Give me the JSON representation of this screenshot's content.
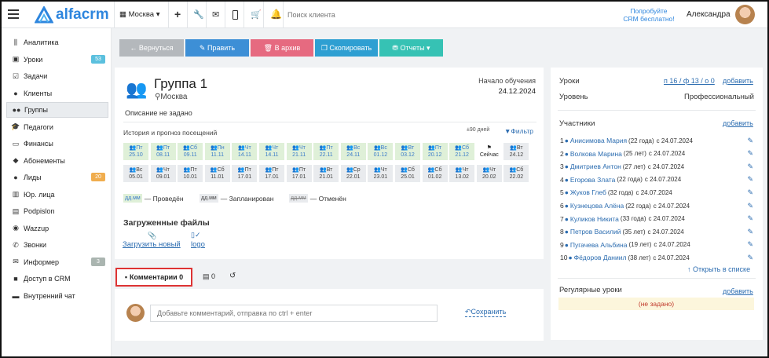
{
  "header": {
    "brand": "alfacrm",
    "city": "Москва",
    "search_placeholder": "Поиск клиента",
    "promo_line1": "Попробуйте",
    "promo_line2": "CRM бесплатно!",
    "user_name": "Александра"
  },
  "sidebar": {
    "items": [
      {
        "label": "Аналитика",
        "icon": "chart-icon",
        "glyph": "⫼"
      },
      {
        "label": "Уроки",
        "icon": "calendar-icon",
        "glyph": "▣",
        "badge": "53",
        "badge_color": "#5bc0de"
      },
      {
        "label": "Задачи",
        "icon": "tasks-icon",
        "glyph": "☑"
      },
      {
        "label": "Клиенты",
        "icon": "user-icon",
        "glyph": "●"
      },
      {
        "label": "Группы",
        "icon": "users-icon",
        "glyph": "●●",
        "active": true
      },
      {
        "label": "Педагоги",
        "icon": "graduation-cap-icon",
        "glyph": "🎓"
      },
      {
        "label": "Финансы",
        "icon": "money-icon",
        "glyph": "▭"
      },
      {
        "label": "Абонементы",
        "icon": "ticket-icon",
        "glyph": "◆"
      },
      {
        "label": "Лиды",
        "icon": "leads-icon",
        "glyph": "●",
        "badge": "20",
        "badge_color": "#f0ad4e"
      },
      {
        "label": "Юр. лица",
        "icon": "building-icon",
        "glyph": "▥"
      },
      {
        "label": "Podpislon",
        "icon": "document-icon",
        "glyph": "▤"
      },
      {
        "label": "Wazzup",
        "icon": "whatsapp-icon",
        "glyph": "◉"
      },
      {
        "label": "Звонки",
        "icon": "phone-icon",
        "glyph": "✆"
      },
      {
        "label": "Информер",
        "icon": "envelope-icon",
        "glyph": "✉",
        "badge": "3",
        "badge_color": "#aab5b0"
      },
      {
        "label": "Доступ в CRM",
        "icon": "lock-icon",
        "glyph": "■"
      },
      {
        "label": "Внутренний чат",
        "icon": "chat-icon",
        "glyph": "▬"
      }
    ]
  },
  "actions": {
    "back": "← Вернуться",
    "edit": "✎ Править",
    "archive": "🗑 В архив",
    "copy": "❐ Скопировать",
    "reports": "⛃ Отчеты ▾"
  },
  "group": {
    "title": "Группа 1",
    "city": "Москва",
    "start_label": "Начало обучения",
    "start_date": "24.12.2024",
    "description": "Описание не задано"
  },
  "attendance": {
    "title": "История и прогноз посещений",
    "days": "±90 дней",
    "filter": "Фильтр",
    "row1": [
      {
        "d": "Пт",
        "date": "25.10",
        "s": "g"
      },
      {
        "d": "Пт",
        "date": "08.11",
        "s": "g"
      },
      {
        "d": "Сб",
        "date": "09.11",
        "s": "g"
      },
      {
        "d": "Пн",
        "date": "11.11",
        "s": "g"
      },
      {
        "d": "Чт",
        "date": "14.11",
        "s": "g"
      },
      {
        "d": "Чт",
        "date": "14.11",
        "s": "g"
      },
      {
        "d": "Чт",
        "date": "21.11",
        "s": "g"
      },
      {
        "d": "Пт",
        "date": "22.11",
        "s": "g"
      },
      {
        "d": "Вс",
        "date": "24.11",
        "s": "g"
      },
      {
        "d": "Вс",
        "date": "01.12",
        "s": "g"
      },
      {
        "d": "Вт",
        "date": "03.12",
        "s": "g"
      },
      {
        "d": "Пт",
        "date": "20.12",
        "s": "g"
      },
      {
        "d": "Сб",
        "date": "21.12",
        "s": "g"
      },
      {
        "d": "",
        "date": "Сейчас",
        "s": "now"
      },
      {
        "d": "Вт",
        "date": "24.12",
        "s": "n"
      }
    ],
    "row2": [
      {
        "d": "Вс",
        "date": "05.01"
      },
      {
        "d": "Чт",
        "date": "09.01"
      },
      {
        "d": "Пт",
        "date": "10.01"
      },
      {
        "d": "Сб",
        "date": "11.01"
      },
      {
        "d": "Пт",
        "date": "17.01"
      },
      {
        "d": "Пт",
        "date": "17.01"
      },
      {
        "d": "Пт",
        "date": "17.01"
      },
      {
        "d": "Вт",
        "date": "21.01"
      },
      {
        "d": "Ср",
        "date": "22.01"
      },
      {
        "d": "Чт",
        "date": "23.01"
      },
      {
        "d": "Сб",
        "date": "25.01"
      },
      {
        "d": "Сб",
        "date": "01.02"
      },
      {
        "d": "Чт",
        "date": "13.02"
      },
      {
        "d": "Чт",
        "date": "20.02"
      },
      {
        "d": "Сб",
        "date": "22.02"
      }
    ],
    "legend": [
      {
        "swatch": "дд.мм",
        "label": "— Проведён"
      },
      {
        "swatch": "дд.мм",
        "label": "— Запланирован"
      },
      {
        "swatch": "дд.мм",
        "label": "— Отменён"
      }
    ]
  },
  "files": {
    "title": "Загруженные файлы",
    "upload": "Загрузить новый",
    "file": "logo"
  },
  "comments": {
    "tab_label": "Комментарии 0",
    "tab2_count": "0",
    "placeholder": "Добавьте комментарий, отправка по ctrl + enter",
    "save": "Сохранить"
  },
  "lessons": {
    "label": "Уроки",
    "stats": "п 16 / ф 13 / о 0",
    "add": "добавить",
    "level_label": "Уровень",
    "level_value": "Профессиональный"
  },
  "participants": {
    "title": "Участники",
    "add": "добавить",
    "open_list": "Открыть в списке",
    "items": [
      {
        "n": "1",
        "name": "Анисимова Мария",
        "age": "(22 года)",
        "since": "с 24.07.2024"
      },
      {
        "n": "2",
        "name": "Волкова Марина",
        "age": "(25 лет)",
        "since": "с 24.07.2024"
      },
      {
        "n": "3",
        "name": "Дмитриев Антон",
        "age": "(27 лет)",
        "since": "с 24.07.2024"
      },
      {
        "n": "4",
        "name": "Егорова Злата",
        "age": "(22 года)",
        "since": "с 24.07.2024"
      },
      {
        "n": "5",
        "name": "Жуков Глеб",
        "age": "(32 года)",
        "since": "с 24.07.2024"
      },
      {
        "n": "6",
        "name": "Кузнецова Алёна",
        "age": "(22 года)",
        "since": "с 24.07.2024"
      },
      {
        "n": "7",
        "name": "Куликов Никита",
        "age": "(33 года)",
        "since": "с 24.07.2024"
      },
      {
        "n": "8",
        "name": "Петров Василий",
        "age": "(35 лет)",
        "since": "с 24.07.2024"
      },
      {
        "n": "9",
        "name": "Пугачева Альбина",
        "age": "(19 лет)",
        "since": "с 24.07.2024"
      },
      {
        "n": "10",
        "name": "Фёдоров Даниил",
        "age": "(38 лет)",
        "since": "с 24.07.2024"
      }
    ]
  },
  "regular": {
    "title": "Регулярные уроки",
    "add": "добавить",
    "empty": "(не задано)"
  },
  "colors": {
    "back": "#b4b8bc",
    "edit": "#3d8fd6",
    "archive": "#e66a80",
    "copy": "#2e9fd2",
    "reports": "#36c2b4",
    "link": "#2b6cb0"
  }
}
